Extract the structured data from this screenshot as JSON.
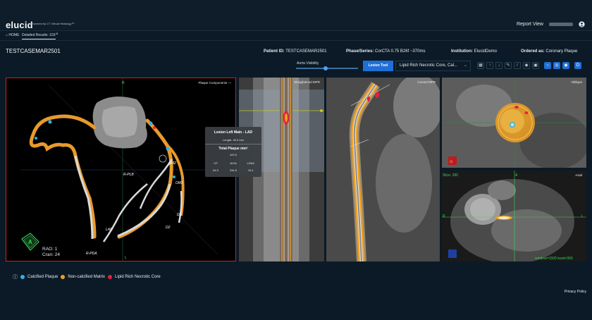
{
  "header": {
    "logo": "elucid",
    "logo_sub": "Powered by CT Virtual Histology™",
    "report_view": "Report View"
  },
  "tabs": {
    "home": "⌂ HOME",
    "detail": "Detailed Results: 103",
    "close": "×"
  },
  "case": {
    "title": "TESTCASEMAR2501",
    "patient_label": "Patient ID:",
    "patient_value": "TESTCASEMAR2501",
    "phase_label": "Phase/Series:",
    "phase_value": "CorCTA 0.75 B26f ~370ms",
    "institution_label": "Institution:",
    "institution_value": "ElucidDemo",
    "ordered_label": "Ordered as:",
    "ordered_value": "Coronary Plaque"
  },
  "controls": {
    "aorta_visibility": "Aorta Visibility",
    "aorta_level": 0.48,
    "lesion_tool": "Lesion Tool",
    "dropdown_value": "Lipid Rich Necrotic Core, Cal...",
    "tool_icons": [
      "grid-icon",
      "arrow-up-icon",
      "arrow-down-icon",
      "pencil-icon",
      "ruler-icon",
      "eye-icon",
      "camera-icon"
    ],
    "view_icons": [
      "view-circle-1-icon",
      "view-circle-2-icon",
      "view-circle-3-icon",
      "view-d-icon"
    ]
  },
  "panels": {
    "plaque_components": "Plaque Components —",
    "straightened_mpr": "Straightened MPR",
    "curved_mpr": "Curved MPR",
    "oblique": "Oblique",
    "axial": "Axial"
  },
  "vessel_labels": [
    "R-PLB",
    "OM2",
    "OM1",
    "D1",
    "D2",
    "LAD",
    "R-PDA"
  ],
  "orientation": {
    "r": "R",
    "l": "L",
    "a": "A",
    "rao": "RAO: 1",
    "cran": "Cran: 24",
    "slice": "Slice: 280",
    "window": "window=1500  level=300"
  },
  "info_card": {
    "title": "Lesion Left Main - LAD",
    "length": "Length: 40.0 mm",
    "total_plaque": "Total Plaque mm³",
    "total_value": "423.9",
    "columns": [
      {
        "label": "CP",
        "value": "54.9"
      },
      {
        "label": "NCM",
        "value": "334.9"
      },
      {
        "label": "LRNC",
        "value": "34.1"
      }
    ]
  },
  "legend": {
    "info": "ⓘ",
    "items": [
      {
        "label": "Calcified Plaque",
        "color": "#29b5e8"
      },
      {
        "label": "Non-calcified Matrix",
        "color": "#f0a020"
      },
      {
        "label": "Lipid Rich Necrotic Core",
        "color": "#e0233b"
      }
    ]
  },
  "footer": {
    "privacy": "Privacy Policy"
  },
  "colors": {
    "accent": "#1f6fd6",
    "plaque_panel_border": "#c0262d",
    "matrix": "#f0a020",
    "calcified": "#29b5e8",
    "lrnc": "#e0233b"
  }
}
